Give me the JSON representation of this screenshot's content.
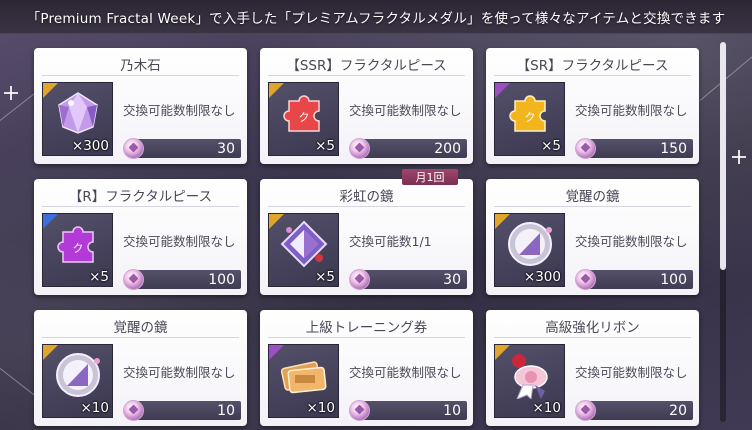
{
  "header": {
    "text": "「Premium Fractal Week」で入手した「プレミアムフラクタルメダル」を使って様々なアイテムと交換できます"
  },
  "colors": {
    "rarity_gold": "#e0a52b",
    "rarity_purple": "#9b4fc0",
    "rarity_blue": "#3c6fd8",
    "badge": "#8a3a5e"
  },
  "currency_icon": "premium-fractal-medal-icon",
  "items": [
    {
      "name": "乃木石",
      "rarity": "gold",
      "icon": "nogi-stone-icon",
      "qty": "×300",
      "limit": "交換可能数制限なし",
      "cost": "30"
    },
    {
      "name": "【SSR】フラクタルピース",
      "rarity": "gold",
      "icon": "red-puzzle-piece-icon",
      "qty": "×5",
      "limit": "交換可能数制限なし",
      "cost": "200"
    },
    {
      "name": "【SR】フラクタルピース",
      "rarity": "purple",
      "icon": "gold-puzzle-piece-icon",
      "qty": "×5",
      "limit": "交換可能数制限なし",
      "cost": "150"
    },
    {
      "name": "【R】フラクタルピース",
      "rarity": "blue",
      "icon": "purple-puzzle-piece-icon",
      "qty": "×5",
      "limit": "交換可能数制限なし",
      "cost": "100"
    },
    {
      "name": "彩虹の鏡",
      "rarity": "gold",
      "icon": "rainbow-mirror-icon",
      "qty": "×5",
      "limit": "交換可能数1/1",
      "cost": "30",
      "badge": "月1回"
    },
    {
      "name": "覚醒の鏡",
      "rarity": "gold",
      "icon": "awakening-mirror-icon",
      "qty": "×300",
      "limit": "交換可能数制限なし",
      "cost": "100"
    },
    {
      "name": "覚醒の鏡",
      "rarity": "gold",
      "icon": "awakening-mirror-icon",
      "qty": "×10",
      "limit": "交換可能数制限なし",
      "cost": "10"
    },
    {
      "name": "上級トレーニング券",
      "rarity": "purple",
      "icon": "training-ticket-icon",
      "qty": "×10",
      "limit": "交換可能数制限なし",
      "cost": "10"
    },
    {
      "name": "高級強化リボン",
      "rarity": "gold",
      "icon": "ribbon-icon",
      "qty": "×10",
      "limit": "交換可能数制限なし",
      "cost": "20"
    }
  ],
  "scrollbar": {
    "position": 0
  }
}
